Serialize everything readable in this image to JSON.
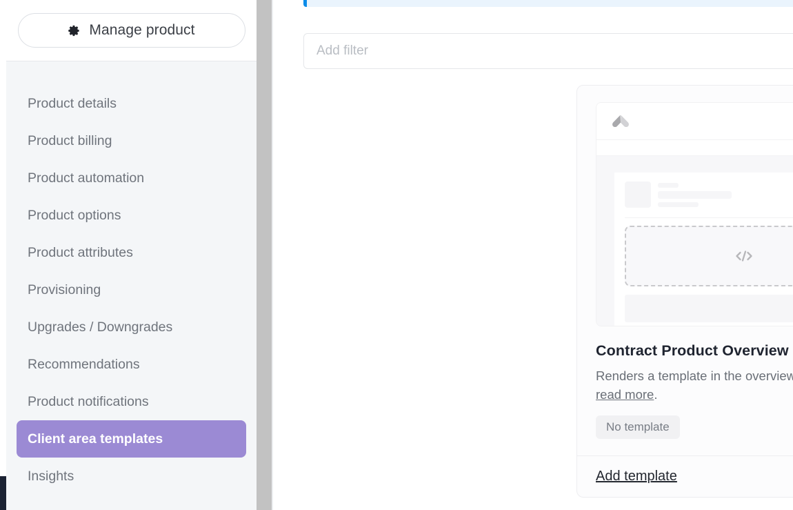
{
  "sidebar": {
    "manage_button": {
      "label": "Manage product",
      "icon": "gear-icon"
    },
    "items": [
      {
        "label": "Product details",
        "active": false
      },
      {
        "label": "Product billing",
        "active": false
      },
      {
        "label": "Product automation",
        "active": false
      },
      {
        "label": "Product options",
        "active": false
      },
      {
        "label": "Product attributes",
        "active": false
      },
      {
        "label": "Provisioning",
        "active": false
      },
      {
        "label": "Upgrades / Downgrades",
        "active": false
      },
      {
        "label": "Recommendations",
        "active": false
      },
      {
        "label": "Product notifications",
        "active": false
      },
      {
        "label": "Client area templates",
        "active": true
      },
      {
        "label": "Insights",
        "active": false
      }
    ],
    "active_item_color": "#9b8ad4",
    "background_color": "#f4f6f8"
  },
  "main": {
    "filter": {
      "placeholder": "Add filter",
      "value": ""
    },
    "banner": {
      "accent_color": "#0c8ce9",
      "background_color": "#eaf4fd"
    }
  },
  "card": {
    "title": "Contract Product Overview",
    "description": "Renders a template in the overview section when ...",
    "read_more_label": "read more",
    "description_suffix": ".",
    "badge_label": "No template",
    "footer_link": "Add template",
    "footer_icon": "chevron-right-icon",
    "preview": {
      "logo_icon": "chevron-up-logo-icon",
      "avatar_icon": "avatar-placeholder",
      "dropzone_icon": "code-icon"
    }
  }
}
